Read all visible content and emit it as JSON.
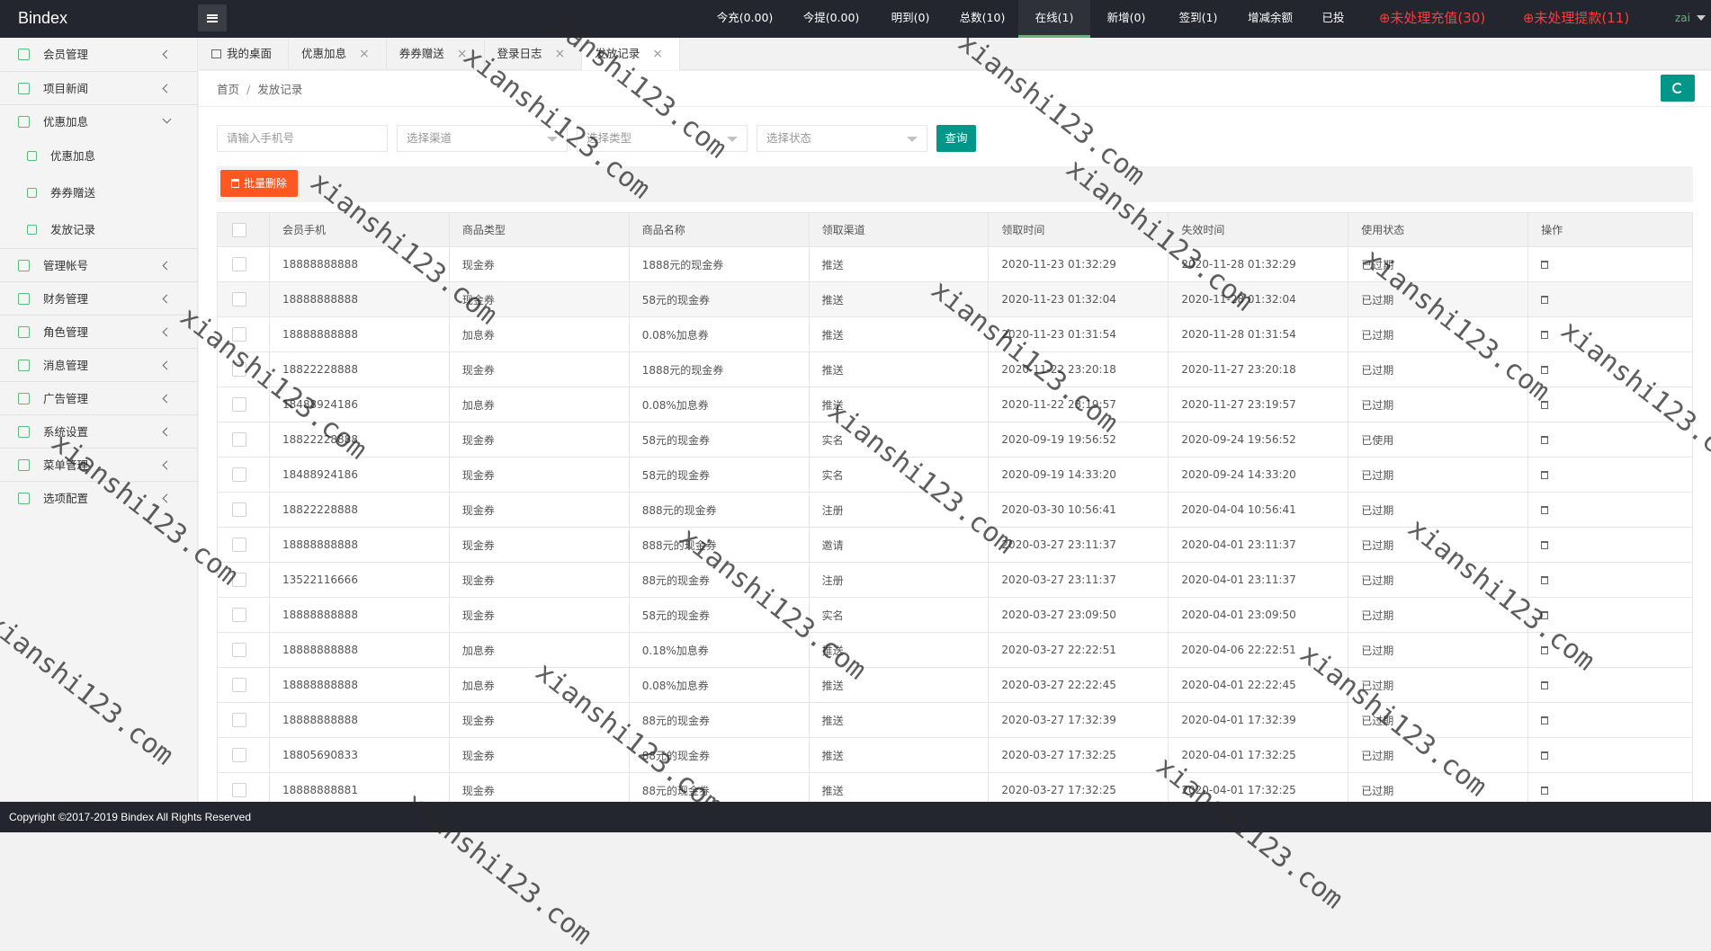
{
  "app": {
    "logo": "Bindex",
    "user": "zai"
  },
  "topnav": [
    {
      "label": "今充(0.00)",
      "width": 96
    },
    {
      "label": "今提(0.00)",
      "width": 96
    },
    {
      "label": "明到(0)",
      "width": 80
    },
    {
      "label": "总数(10)",
      "width": 80
    },
    {
      "label": "在线(1)",
      "width": 80,
      "active": true
    },
    {
      "label": "新增(0)",
      "width": 80
    },
    {
      "label": "签到(1)",
      "width": 80
    },
    {
      "label": "增减余额",
      "width": 80
    },
    {
      "label": "已投",
      "width": 60
    },
    {
      "label": "⊕未处理充值(30)",
      "width": 160,
      "alert": true
    },
    {
      "label": "⊕未处理提款(11)",
      "width": 160,
      "alert": true
    }
  ],
  "sidebar": {
    "items": [
      {
        "label": "会员管理",
        "icon": "user-icon"
      },
      {
        "label": "项目新闻",
        "icon": "book-icon"
      },
      {
        "label": "优惠加息",
        "icon": "image-icon",
        "expanded": true,
        "children": [
          {
            "label": "优惠加息",
            "icon": "car-icon"
          },
          {
            "label": "券券赠送",
            "icon": "send-icon"
          },
          {
            "label": "发放记录",
            "icon": "list-icon"
          }
        ]
      },
      {
        "label": "管理帐号",
        "icon": "users-icon"
      },
      {
        "label": "财务管理",
        "icon": "yen-icon"
      },
      {
        "label": "角色管理",
        "icon": "shield-icon"
      },
      {
        "label": "消息管理",
        "icon": "speaker-icon"
      },
      {
        "label": "广告管理",
        "icon": "picture-icon"
      },
      {
        "label": "系统设置",
        "icon": "gear-icon"
      },
      {
        "label": "菜单管理",
        "icon": "grid-icon"
      },
      {
        "label": "选项配置",
        "icon": "tools-icon"
      }
    ]
  },
  "tabs": [
    {
      "label": "我的桌面",
      "home": true
    },
    {
      "label": "优惠加息",
      "closable": true
    },
    {
      "label": "券券赠送",
      "closable": true
    },
    {
      "label": "登录日志",
      "closable": true
    },
    {
      "label": "发放记录",
      "closable": true,
      "active": true
    }
  ],
  "breadcrumb": {
    "home": "首页",
    "sep": "/",
    "current": "发放记录"
  },
  "filters": {
    "phone_placeholder": "请输入手机号",
    "channel_placeholder": "选择渠道",
    "type_placeholder": "选择类型",
    "status_placeholder": "选择状态",
    "query_label": "查询"
  },
  "toolbar": {
    "batch_delete_label": "批量删除"
  },
  "table": {
    "headers": [
      "会员手机",
      "商品类型",
      "商品名称",
      "领取渠道",
      "领取时间",
      "失效时间",
      "使用状态",
      "操作"
    ],
    "rows": [
      [
        "18888888888",
        "现金券",
        "1888元的现金券",
        "推送",
        "2020-11-23 01:32:29",
        "2020-11-28 01:32:29",
        "已过期"
      ],
      [
        "18888888888",
        "现金券",
        "58元的现金券",
        "推送",
        "2020-11-23 01:32:04",
        "2020-11-28 01:32:04",
        "已过期"
      ],
      [
        "18888888888",
        "加息券",
        "0.08%加息券",
        "推送",
        "2020-11-23 01:31:54",
        "2020-11-28 01:31:54",
        "已过期"
      ],
      [
        "18822228888",
        "现金券",
        "1888元的现金券",
        "推送",
        "2020-11-22 23:20:18",
        "2020-11-27 23:20:18",
        "已过期"
      ],
      [
        "18488924186",
        "加息券",
        "0.08%加息券",
        "推送",
        "2020-11-22 23:19:57",
        "2020-11-27 23:19:57",
        "已过期"
      ],
      [
        "18822228888",
        "现金券",
        "58元的现金券",
        "实名",
        "2020-09-19 19:56:52",
        "2020-09-24 19:56:52",
        "已使用"
      ],
      [
        "18488924186",
        "现金券",
        "58元的现金券",
        "实名",
        "2020-09-19 14:33:20",
        "2020-09-24 14:33:20",
        "已过期"
      ],
      [
        "18822228888",
        "现金券",
        "888元的现金券",
        "注册",
        "2020-03-30 10:56:41",
        "2020-04-04 10:56:41",
        "已过期"
      ],
      [
        "18888888888",
        "现金券",
        "888元的现金券",
        "邀请",
        "2020-03-27 23:11:37",
        "2020-04-01 23:11:37",
        "已过期"
      ],
      [
        "13522116666",
        "现金券",
        "88元的现金券",
        "注册",
        "2020-03-27 23:11:37",
        "2020-04-01 23:11:37",
        "已过期"
      ],
      [
        "18888888888",
        "现金券",
        "58元的现金券",
        "实名",
        "2020-03-27 23:09:50",
        "2020-04-01 23:09:50",
        "已过期"
      ],
      [
        "18888888888",
        "加息券",
        "0.18%加息券",
        "推送",
        "2020-03-27 22:22:51",
        "2020-04-06 22:22:51",
        "已过期"
      ],
      [
        "18888888888",
        "加息券",
        "0.08%加息券",
        "推送",
        "2020-03-27 22:22:45",
        "2020-04-01 22:22:45",
        "已过期"
      ],
      [
        "18888888888",
        "现金券",
        "88元的现金券",
        "推送",
        "2020-03-27 17:32:39",
        "2020-04-01 17:32:39",
        "已过期"
      ],
      [
        "18805690833",
        "现金券",
        "88元的现金券",
        "推送",
        "2020-03-27 17:32:25",
        "2020-04-01 17:32:25",
        "已过期"
      ],
      [
        "18888888881",
        "现金券",
        "88元的现金券",
        "推送",
        "2020-03-27 17:32:25",
        "2020-04-01 17:32:25",
        "已过期"
      ]
    ]
  },
  "footer": {
    "copyright": "Copyright ©2017-2019 Bindex All Rights Reserved"
  },
  "watermark": {
    "text": "xianshi123.com"
  },
  "colors": {
    "accent": "#009688",
    "green": "#5fb878",
    "danger": "#ff5722",
    "alert": "#ff3b3b",
    "dark": "#23262e"
  }
}
